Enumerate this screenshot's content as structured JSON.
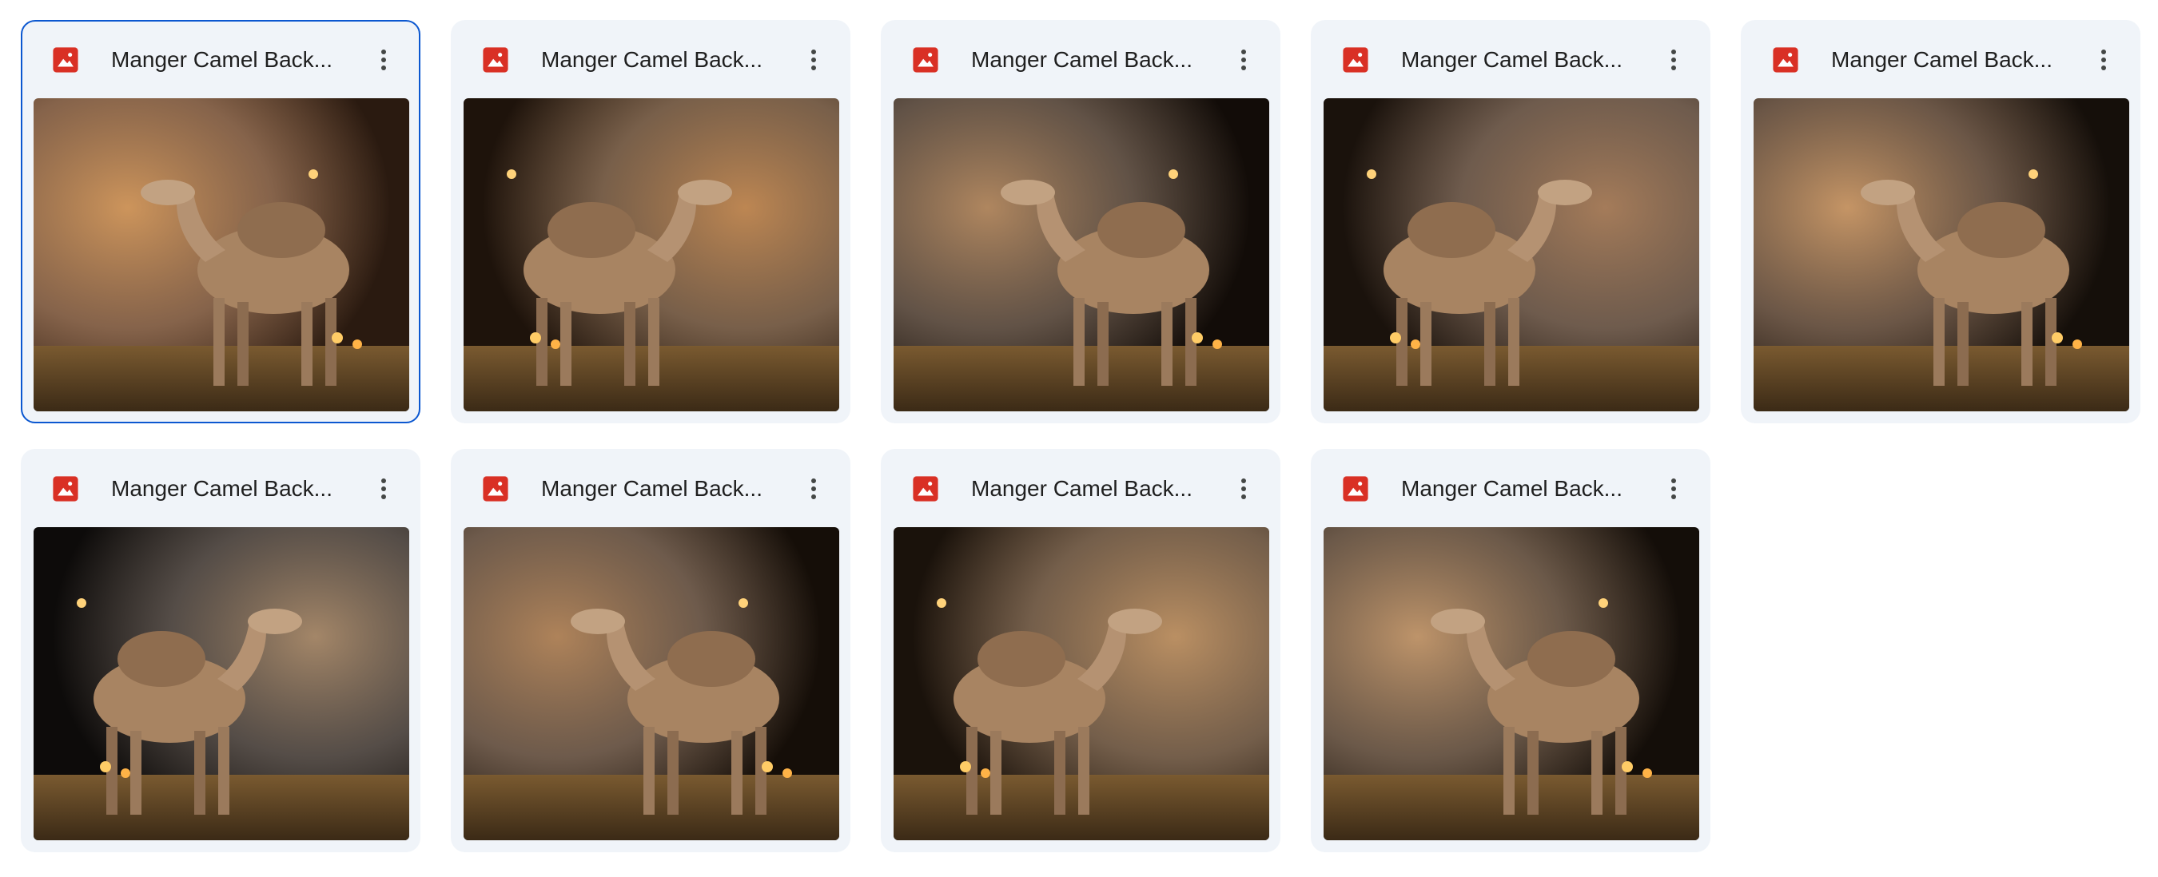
{
  "files": [
    {
      "title": "Manger Camel Back...",
      "selected": true,
      "icon": "image-file-icon",
      "thumb_alt": "camel-photo-1"
    },
    {
      "title": "Manger Camel Back...",
      "selected": false,
      "icon": "image-file-icon",
      "thumb_alt": "camel-photo-2"
    },
    {
      "title": "Manger Camel Back...",
      "selected": false,
      "icon": "image-file-icon",
      "thumb_alt": "camel-photo-3"
    },
    {
      "title": "Manger Camel Back...",
      "selected": false,
      "icon": "image-file-icon",
      "thumb_alt": "camel-photo-4"
    },
    {
      "title": "Manger Camel Back...",
      "selected": false,
      "icon": "image-file-icon",
      "thumb_alt": "camel-photo-5"
    },
    {
      "title": "Manger Camel Back...",
      "selected": false,
      "icon": "image-file-icon",
      "thumb_alt": "camel-photo-6"
    },
    {
      "title": "Manger Camel Back...",
      "selected": false,
      "icon": "image-file-icon",
      "thumb_alt": "camel-photo-7"
    },
    {
      "title": "Manger Camel Back...",
      "selected": false,
      "icon": "image-file-icon",
      "thumb_alt": "camel-photo-8"
    },
    {
      "title": "Manger Camel Back...",
      "selected": false,
      "icon": "image-file-icon",
      "thumb_alt": "camel-photo-9"
    }
  ],
  "colors": {
    "selected_border": "#0b57d0",
    "card_bg": "#f0f4f9",
    "image_icon": "#d93025"
  }
}
